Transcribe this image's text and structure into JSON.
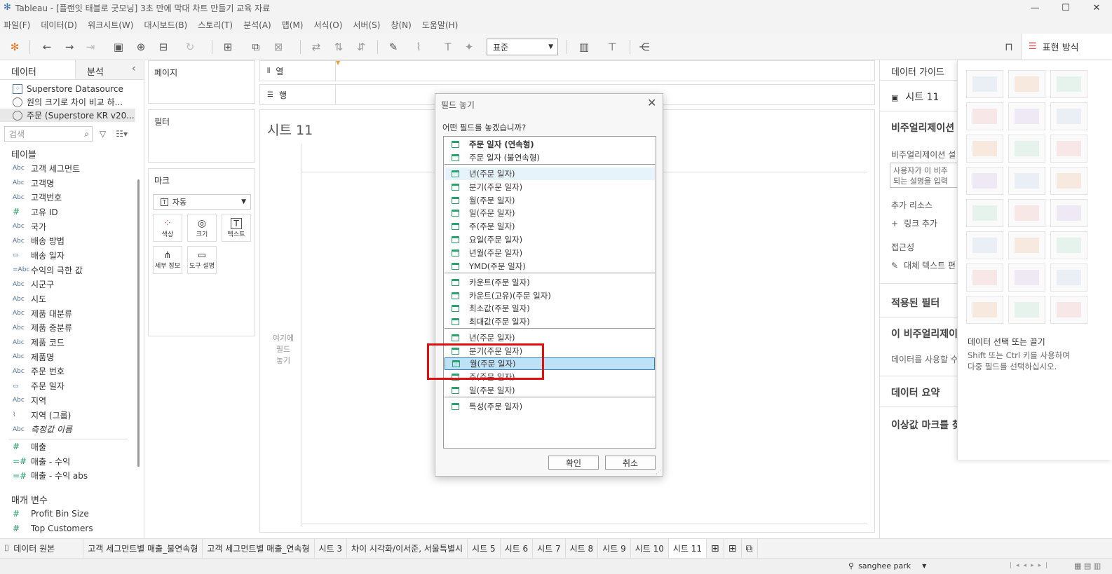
{
  "window": {
    "title": "Tableau - [플랜잇 태블로 굿모닝] 3초 만에 막대 차트 만들기 교육 자료",
    "minimize": "—",
    "maximize": "☐",
    "close": "✕"
  },
  "menu": [
    "파일(F)",
    "데이터(D)",
    "워크시트(W)",
    "대시보드(B)",
    "스토리(T)",
    "분석(A)",
    "맵(M)",
    "서식(O)",
    "서버(S)",
    "창(N)",
    "도움말(H)"
  ],
  "toolbar": {
    "fit_select": "표준",
    "showme_label": "표현 방식"
  },
  "left": {
    "tab_data": "데이터",
    "tab_analysis": "분석",
    "collapse": "‹",
    "datasources": [
      "Superstore Datasource",
      "원의 크기로 차이 비교 하...",
      "주문 (Superstore KR v20..."
    ],
    "search_placeholder": "검색",
    "tables_header": "테이블",
    "fields": [
      {
        "type": "Abc",
        "name": "고객 세그먼트"
      },
      {
        "type": "Abc",
        "name": "고객명"
      },
      {
        "type": "Abc",
        "name": "고객번호"
      },
      {
        "type": "#",
        "name": "고유 ID"
      },
      {
        "type": "Abc",
        "name": "국가"
      },
      {
        "type": "Abc",
        "name": "배송 방법"
      },
      {
        "type": "date",
        "name": "배송 일자"
      },
      {
        "type": "=Abc",
        "name": "수익의 극한 값"
      },
      {
        "type": "Abc",
        "name": "시군구"
      },
      {
        "type": "Abc",
        "name": "시도"
      },
      {
        "type": "Abc",
        "name": "제품 대분류"
      },
      {
        "type": "Abc",
        "name": "제품 중분류"
      },
      {
        "type": "Abc",
        "name": "제품 코드"
      },
      {
        "type": "Abc",
        "name": "제품명"
      },
      {
        "type": "Abc",
        "name": "주문 번호"
      },
      {
        "type": "date",
        "name": "주문 일자"
      },
      {
        "type": "Abc",
        "name": "지역"
      },
      {
        "type": "clip",
        "name": "지역 (그룹)"
      },
      {
        "type": "Abc",
        "name": "측정값 이름"
      }
    ],
    "measures": [
      {
        "type": "#",
        "name": "매출"
      },
      {
        "type": "=#",
        "name": "매출 - 수익"
      },
      {
        "type": "=#",
        "name": "매출 - 수익 abs"
      }
    ],
    "params_header": "매개 변수",
    "params": [
      {
        "type": "#",
        "name": "Profit Bin Size"
      },
      {
        "type": "#",
        "name": "Top Customers"
      }
    ]
  },
  "shelves": {
    "pages": "페이지",
    "filters": "필터",
    "marks": "마크",
    "marks_type": "자동",
    "mark_buttons": [
      "색상",
      "크기",
      "텍스트",
      "세부 정보",
      "도구 설명"
    ],
    "columns": "열",
    "rows": "행"
  },
  "viz": {
    "sheet_title": "시트 11",
    "drop_hint": "여기에\n필드\n놓기"
  },
  "right": {
    "header": "데이터 가이드",
    "sheet": "시트 11",
    "vis_heading": "비주얼리제이션",
    "vis_desc_label": "비주얼리제이션 설",
    "vis_desc_placeholder": "사용자가 이 비주\n되는 설명을 입력",
    "extra_resources": "추가 리소스",
    "add_link": "링크 추가",
    "accessibility": "접근성",
    "alt_text": "대체 텍스트 편",
    "applied_filters": "적용된 필터",
    "this_vis": "이 비주얼리제이",
    "use_data": "데이터를 사용할 수",
    "data_summary": "데이터 요약",
    "outliers": "이상값 마크를 찾"
  },
  "showme": {
    "title": "데이터 선택 또는 끌기",
    "hint": "Shift 또는 Ctrl 키를 사용하여\n다중 필드를 선택하십시오."
  },
  "dialog": {
    "title": "필드 놓기",
    "question": "어떤 필드를 놓겠습니까?",
    "items": [
      "주문 일자 (연속형)",
      "주문 일자 (불연속형)",
      "년(주문 일자)",
      "분기(주문 일자)",
      "월(주문 일자)",
      "일(주문 일자)",
      "주(주문 일자)",
      "요일(주문 일자)",
      "년월(주문 일자)",
      "YMD(주문 일자)",
      "카운트(주문 일자)",
      "카운트(고유)(주문 일자)",
      "최소값(주문 일자)",
      "최대값(주문 일자)",
      "년(주문 일자)",
      "분기(주문 일자)",
      "월(주문 일자)",
      "주(주문 일자)",
      "일(주문 일자)",
      "특성(주문 일자)"
    ],
    "ok": "확인",
    "cancel": "취소"
  },
  "sheets": [
    "데이터 원본",
    "고객 세그먼트별 매출_불연속형",
    "고객 세그먼트별 매출_연속형",
    "시트 3",
    "차이 시각화/이서준, 서울특별시",
    "시트 5",
    "시트 6",
    "시트 7",
    "시트 8",
    "시트 9",
    "시트 10",
    "시트 11"
  ],
  "status": {
    "user": "sanghee park"
  }
}
